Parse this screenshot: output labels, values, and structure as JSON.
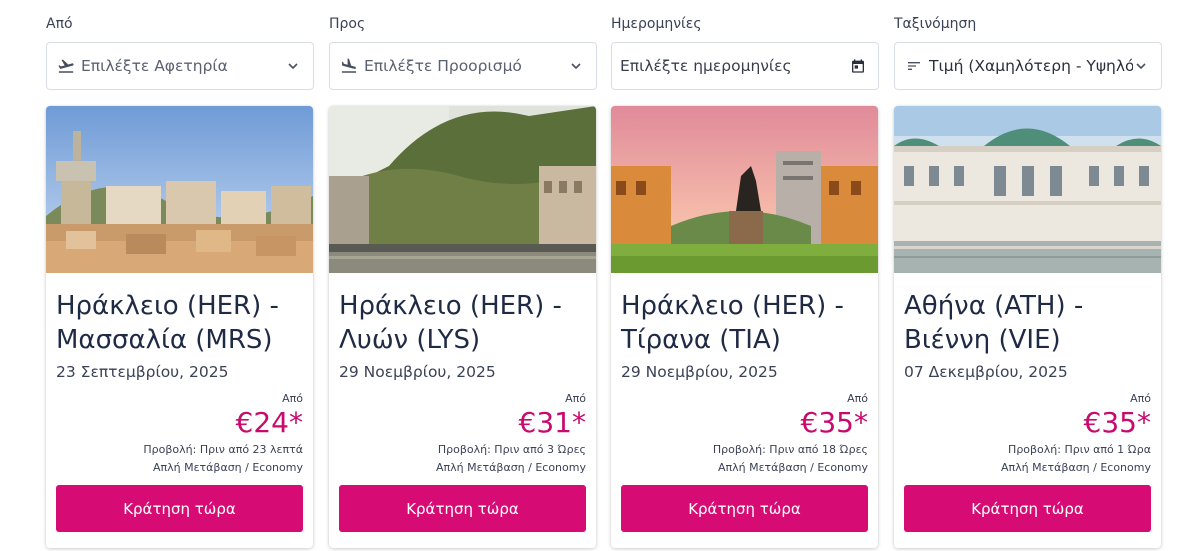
{
  "filters": {
    "from": {
      "label": "Από",
      "placeholder": "Επιλέξτε Αφετηρία",
      "icon": "plane-takeoff-icon"
    },
    "to": {
      "label": "Προς",
      "placeholder": "Επιλέξτε Προορισμό",
      "icon": "plane-landing-icon"
    },
    "dates": {
      "label": "Ημερομηνίες",
      "placeholder": "Επιλέξτε ημερομηνίες",
      "icon": "calendar-icon"
    },
    "sort": {
      "label": "Ταξινόμηση",
      "value": "Τιμή (Χαμηλότερη - Υψηλότ",
      "icon": "sort-icon"
    }
  },
  "colors": {
    "accent": "#d60b74",
    "price": "#c70a6c",
    "text": "#1f2a44"
  },
  "cards": [
    {
      "title_line1": "Ηράκλειο (HER) -",
      "title_line2": "Μασσαλία (MRS)",
      "date": "23 Σεπτεμβρίου, 2025",
      "from_label": "Από",
      "price": "€24*",
      "view": "Προβολή: Πριν από 23 λεπτά",
      "type": "Απλή Μετάβαση / Economy",
      "button": "Κράτηση τώρα",
      "image": "marseille-photo"
    },
    {
      "title_line1": "Ηράκλειο (HER) -",
      "title_line2": "Λυών (LYS)",
      "date": "29 Νοεμβρίου, 2025",
      "from_label": "Από",
      "price": "€31*",
      "view": "Προβολή: Πριν από 3 Ώρες",
      "type": "Απλή Μετάβαση / Economy",
      "button": "Κράτηση τώρα",
      "image": "lyon-photo"
    },
    {
      "title_line1": "Ηράκλειο (HER) -",
      "title_line2": "Τίρανα (TIA)",
      "date": "29 Νοεμβρίου, 2025",
      "from_label": "Από",
      "price": "€35*",
      "view": "Προβολή: Πριν από 18 Ώρες",
      "type": "Απλή Μετάβαση / Economy",
      "button": "Κράτηση τώρα",
      "image": "tirana-photo"
    },
    {
      "title_line1": "Αθήνα (ATH) -",
      "title_line2": "Βιέννη (VIE)",
      "date": "07 Δεκεμβρίου, 2025",
      "from_label": "Από",
      "price": "€35*",
      "view": "Προβολή: Πριν από 1 Ώρα",
      "type": "Απλή Μετάβαση / Economy",
      "button": "Κράτηση τώρα",
      "image": "vienna-photo"
    }
  ]
}
